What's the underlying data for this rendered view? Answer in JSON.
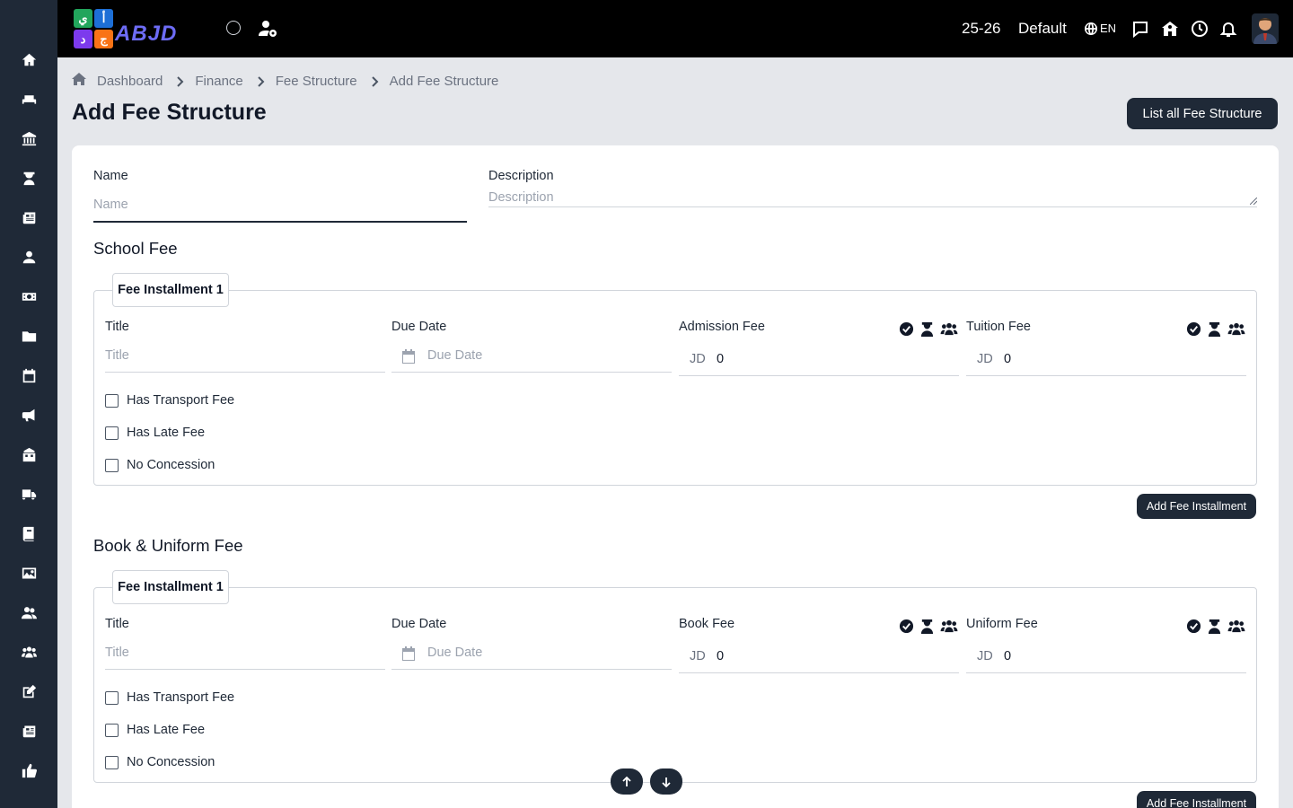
{
  "sidebar": {
    "items": [
      {
        "icon": "home-icon",
        "name": "sidebar-item-home"
      },
      {
        "icon": "sofa-icon",
        "name": "sidebar-item-furniture"
      },
      {
        "icon": "institution-icon",
        "name": "sidebar-item-institution"
      },
      {
        "icon": "teacher-icon",
        "name": "sidebar-item-teachers"
      },
      {
        "icon": "newspaper-icon",
        "name": "sidebar-item-news"
      },
      {
        "icon": "user-icon",
        "name": "sidebar-item-students"
      },
      {
        "icon": "money-icon",
        "name": "sidebar-item-finance"
      },
      {
        "icon": "folder-icon",
        "name": "sidebar-item-files"
      },
      {
        "icon": "calendar-icon",
        "name": "sidebar-item-calendar"
      },
      {
        "icon": "megaphone-icon",
        "name": "sidebar-item-announcements"
      },
      {
        "icon": "school-icon",
        "name": "sidebar-item-school"
      },
      {
        "icon": "truck-icon",
        "name": "sidebar-item-transport"
      },
      {
        "icon": "book-icon",
        "name": "sidebar-item-library"
      },
      {
        "icon": "image-icon",
        "name": "sidebar-item-gallery"
      },
      {
        "icon": "users-icon",
        "name": "sidebar-item-users"
      },
      {
        "icon": "groups-icon",
        "name": "sidebar-item-groups"
      },
      {
        "icon": "edit-icon",
        "name": "sidebar-item-exams"
      },
      {
        "icon": "newspaper-alt-icon",
        "name": "sidebar-item-reports"
      },
      {
        "icon": "thumbs-up-icon",
        "name": "sidebar-item-feedback"
      }
    ]
  },
  "header": {
    "logo_text": "ABJD",
    "logo_tiles": [
      "ي",
      "أ",
      "د",
      "ج"
    ],
    "session": "25-26",
    "profile": "Default",
    "language": "EN"
  },
  "breadcrumb": [
    "Dashboard",
    "Finance",
    "Fee Structure",
    "Add Fee Structure"
  ],
  "page": {
    "title": "Add Fee Structure",
    "list_button": "List all Fee Structure"
  },
  "form": {
    "name_label": "Name",
    "name_placeholder": "Name",
    "description_label": "Description",
    "description_placeholder": "Description"
  },
  "sections": [
    {
      "title": "School Fee",
      "installment": "Fee Installment 1",
      "title_label": "Title",
      "title_placeholder": "Title",
      "due_label": "Due Date",
      "due_placeholder": "Due Date",
      "fee1_label": "Admission Fee",
      "fee2_label": "Tuition Fee",
      "currency": "JD",
      "fee1_value": "0",
      "fee2_value": "0",
      "checks": [
        "Has Transport Fee",
        "Has Late Fee",
        "No Concession"
      ],
      "add_button": "Add Fee Installment"
    },
    {
      "title": "Book & Uniform Fee",
      "installment": "Fee Installment 1",
      "title_label": "Title",
      "title_placeholder": "Title",
      "due_label": "Due Date",
      "due_placeholder": "Due Date",
      "fee1_label": "Book Fee",
      "fee2_label": "Uniform Fee",
      "currency": "JD",
      "fee1_value": "0",
      "fee2_value": "0",
      "checks": [
        "Has Transport Fee",
        "Has Late Fee",
        "No Concession"
      ],
      "add_button": "Add Fee Installment"
    }
  ],
  "colors": {
    "sidebar": "#1f2937",
    "topbar": "#000000",
    "accent": "#1f2937",
    "background": "#e5e7eb"
  }
}
